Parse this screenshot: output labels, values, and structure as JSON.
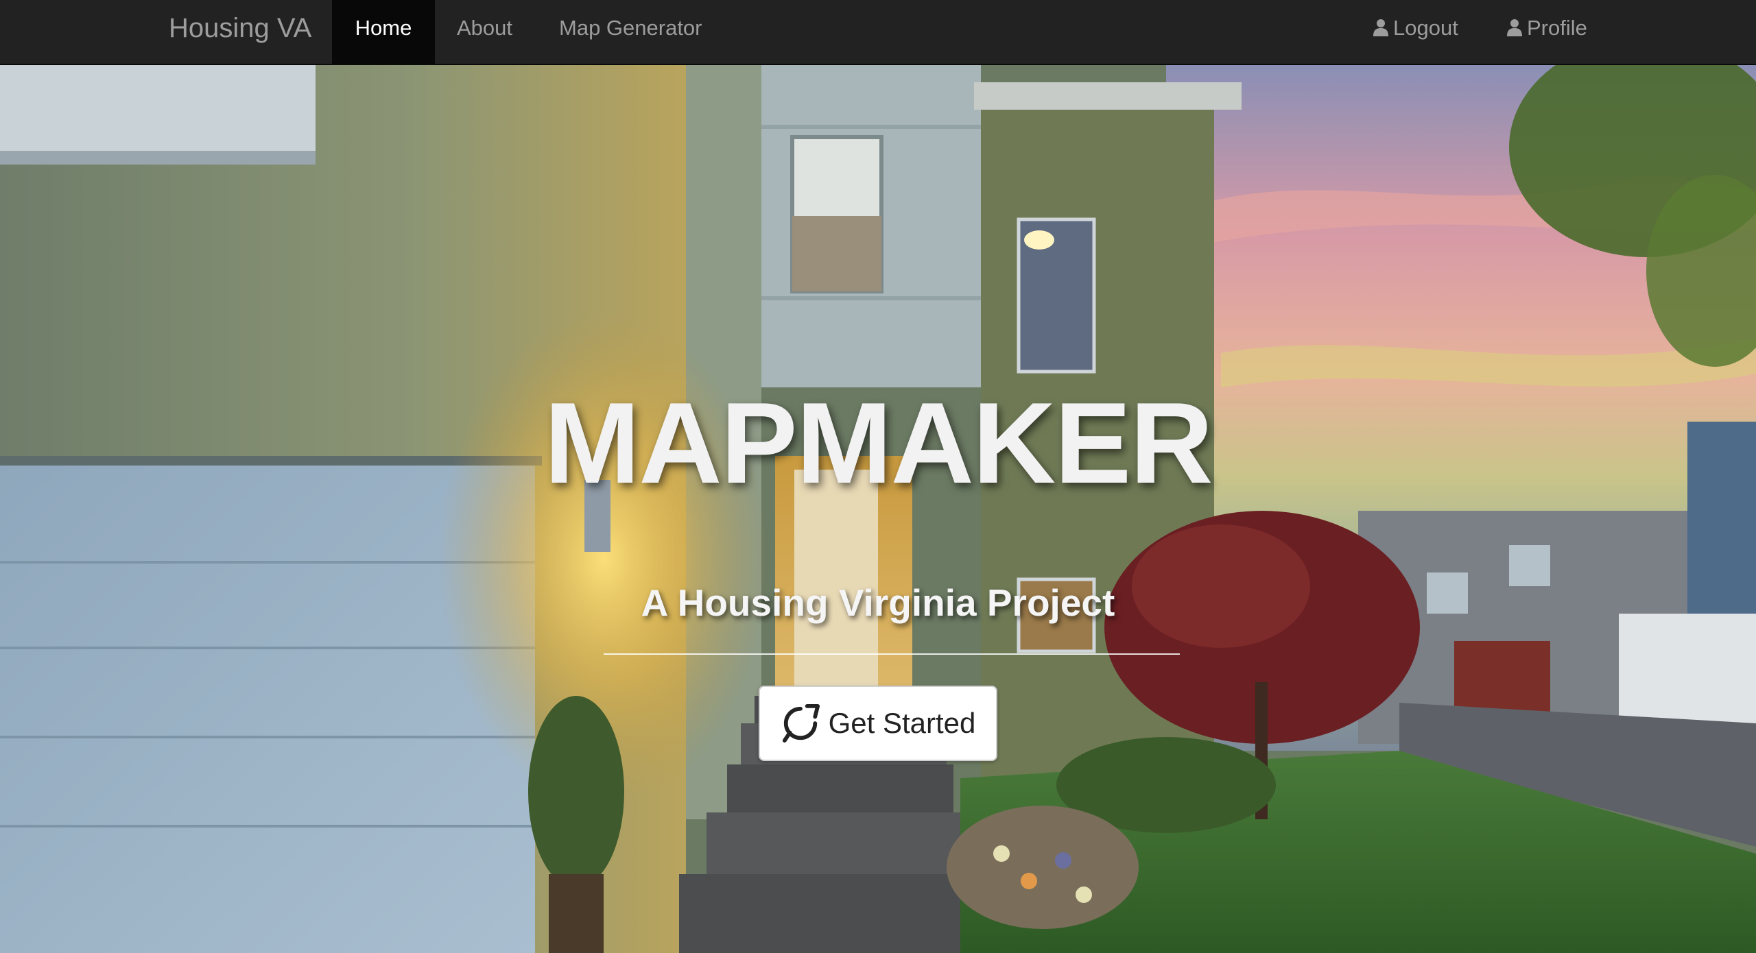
{
  "navbar": {
    "brand": "Housing VA",
    "links": [
      {
        "label": "Home",
        "active": true
      },
      {
        "label": "About",
        "active": false
      },
      {
        "label": "Map Generator",
        "active": false
      }
    ],
    "right_links": [
      {
        "label": "Logout",
        "icon": "user-icon"
      },
      {
        "label": "Profile",
        "icon": "user-icon"
      }
    ]
  },
  "hero": {
    "title": "MAPMAKER",
    "subtitle": "A Housing Virginia Project",
    "cta_label": "Get Started",
    "cta_icon": "refresh-icon",
    "background": "house-at-dusk-photo"
  },
  "colors": {
    "navbar_bg": "#222222",
    "navbar_active_bg": "#080808",
    "nav_text": "#9d9d9d",
    "nav_text_active": "#ffffff",
    "button_bg": "#ffffff"
  }
}
